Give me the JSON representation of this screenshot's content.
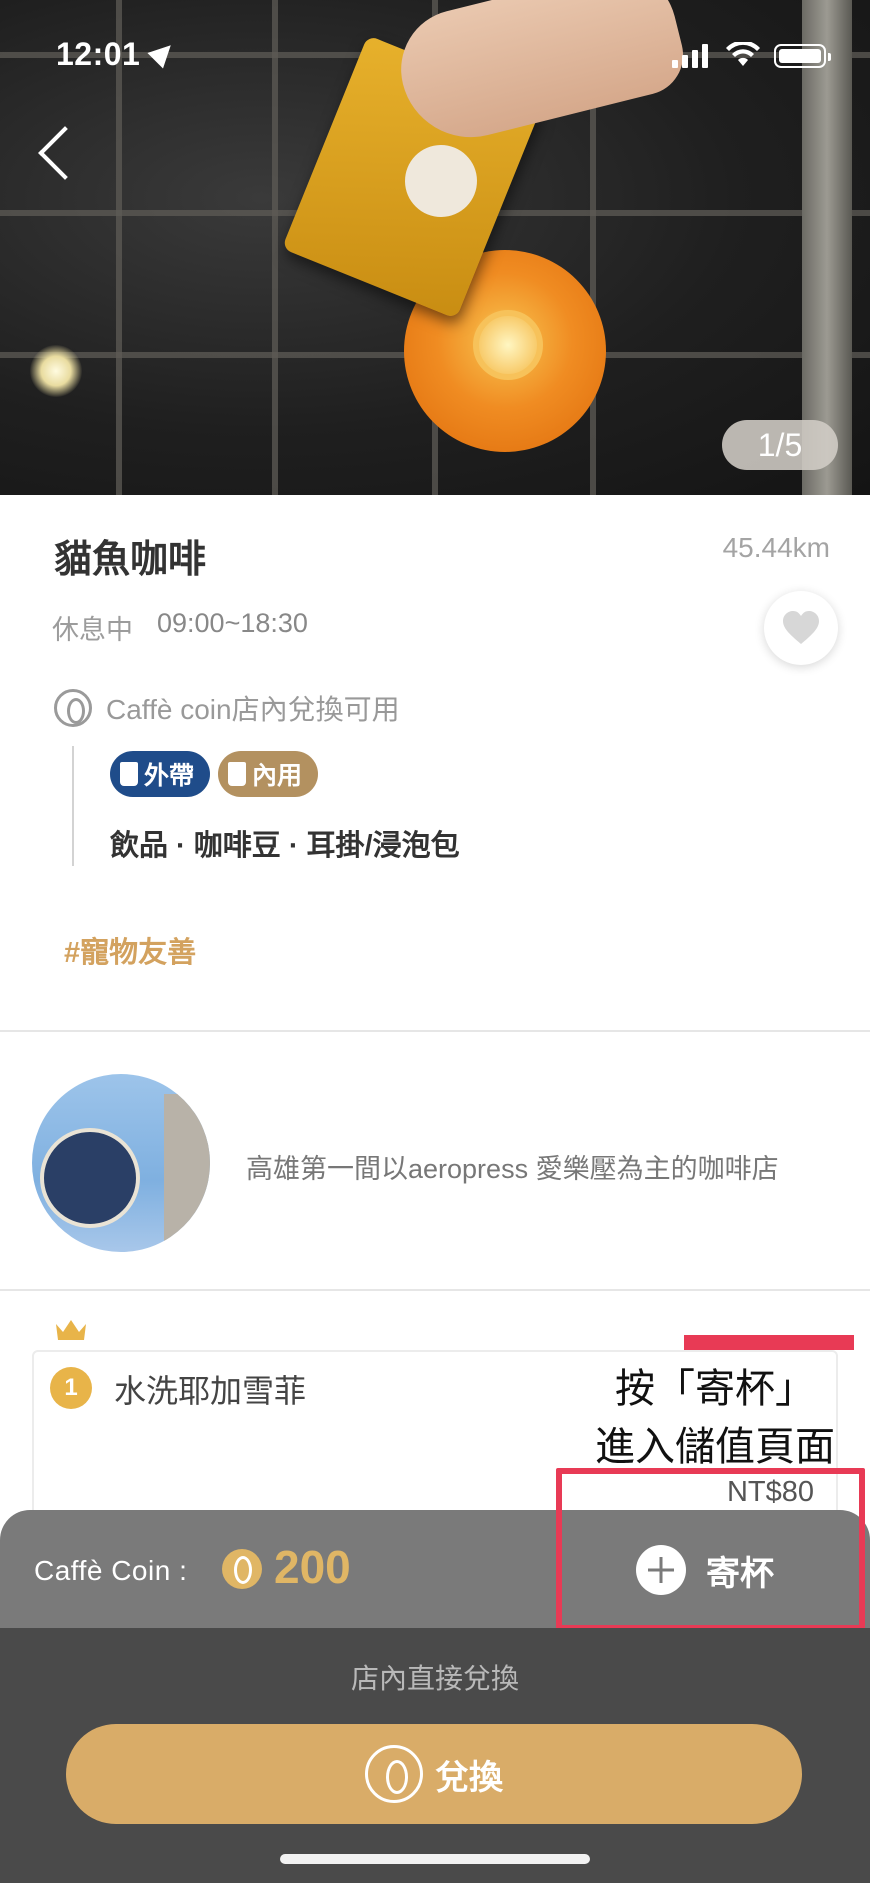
{
  "status_bar": {
    "time": "12:01"
  },
  "hero": {
    "pager": "1/5"
  },
  "store": {
    "name": "貓魚咖啡",
    "distance": "45.44km",
    "status": "休息中",
    "hours": "09:00~18:30",
    "coin_available": "Caffè coin店內兌換可用",
    "tags": {
      "takeout": "外帶",
      "dine_in": "內用"
    },
    "categories": "飲品 · 咖啡豆 · 耳掛/浸泡包",
    "hashtag": "#寵物友善",
    "description": "高雄第一間以aeropress 愛樂壓為主的咖啡店"
  },
  "ranked_item": {
    "rank": "1",
    "name": "水洗耶加雪菲",
    "price": "NT$80"
  },
  "annotation": {
    "line1": "按「寄杯」",
    "line2": "進入儲值頁面",
    "color": "#e83a55"
  },
  "coin_bar": {
    "label": "Caffè Coin :",
    "amount": "200",
    "deposit_label": "寄杯"
  },
  "exchange": {
    "hint": "店內直接兌換",
    "button_label": "兌換"
  },
  "colors": {
    "gold": "#d9ac68",
    "navy": "#1f4c8a",
    "tan": "#b39160"
  },
  "icons": [
    "back-icon",
    "heart-icon",
    "coin-icon",
    "cup-icon",
    "crown-icon",
    "plus-icon",
    "bean-icon"
  ]
}
